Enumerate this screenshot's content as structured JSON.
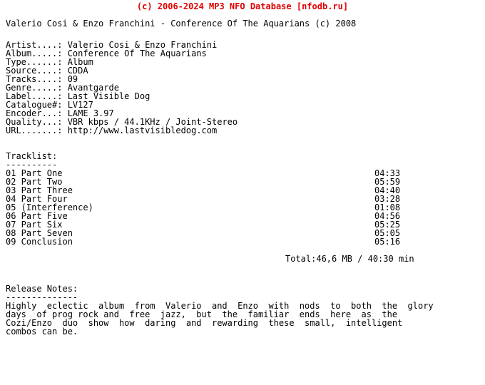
{
  "banner": {
    "text": "(c) 2006-2024 MP3 NFO Database [nfodb.ru]",
    "color": "#e00000"
  },
  "header": {
    "title": "Valerio Cosi & Enzo Franchini - Conference Of The Aquarians (c) 2008"
  },
  "info": {
    "rows": [
      {
        "key": "Artist....:",
        "value": "Valerio Cosi & Enzo Franchini"
      },
      {
        "key": "Album.....:",
        "value": "Conference Of The Aquarians"
      },
      {
        "key": "Type......:",
        "value": "Album"
      },
      {
        "key": "Source....:",
        "value": "CDDA"
      },
      {
        "key": "Tracks....:",
        "value": "09"
      },
      {
        "key": "Genre.....:",
        "value": "Avantgarde"
      },
      {
        "key": "Label.....:",
        "value": "Last Visible Dog"
      },
      {
        "key": "Catalogue#:",
        "value": "LV127"
      },
      {
        "key": "Encoder...:",
        "value": "LAME 3.97"
      },
      {
        "key": "Quality...:",
        "value": "VBR kbps / 44.1KHz / Joint-Stereo"
      },
      {
        "key": "URL.......:",
        "value": "http://www.lastvisibledog.com"
      }
    ]
  },
  "tracklist": {
    "heading": "Tracklist:",
    "rule": "----------",
    "tracks": [
      {
        "label": "01 Part One",
        "time": "04:33"
      },
      {
        "label": "02 Part Two",
        "time": "05:59"
      },
      {
        "label": "03 Part Three",
        "time": "04:40"
      },
      {
        "label": "04 Part Four",
        "time": "03:28"
      },
      {
        "label": "05 (Interference)",
        "time": "01:08"
      },
      {
        "label": "06 Part Five",
        "time": "04:56"
      },
      {
        "label": "07 Part Six",
        "time": "05:25"
      },
      {
        "label": "08 Part Seven",
        "time": "05:05"
      },
      {
        "label": "09 Conclusion",
        "time": "05:16"
      }
    ],
    "total": "Total:46,6 MB / 40:30 min"
  },
  "notes": {
    "heading": "Release Notes:",
    "rule": "--------------",
    "lines": [
      "Highly  eclectic  album  from  Valerio  and  Enzo  with  nods  to  both  the  glory",
      "days  of prog rock and  free  jazz,  but  the  familiar  ends  here  as  the",
      "Cozi/Enzo  duo  show  how  daring  and  rewarding  these  small,  intelligent",
      "combos can be."
    ]
  }
}
